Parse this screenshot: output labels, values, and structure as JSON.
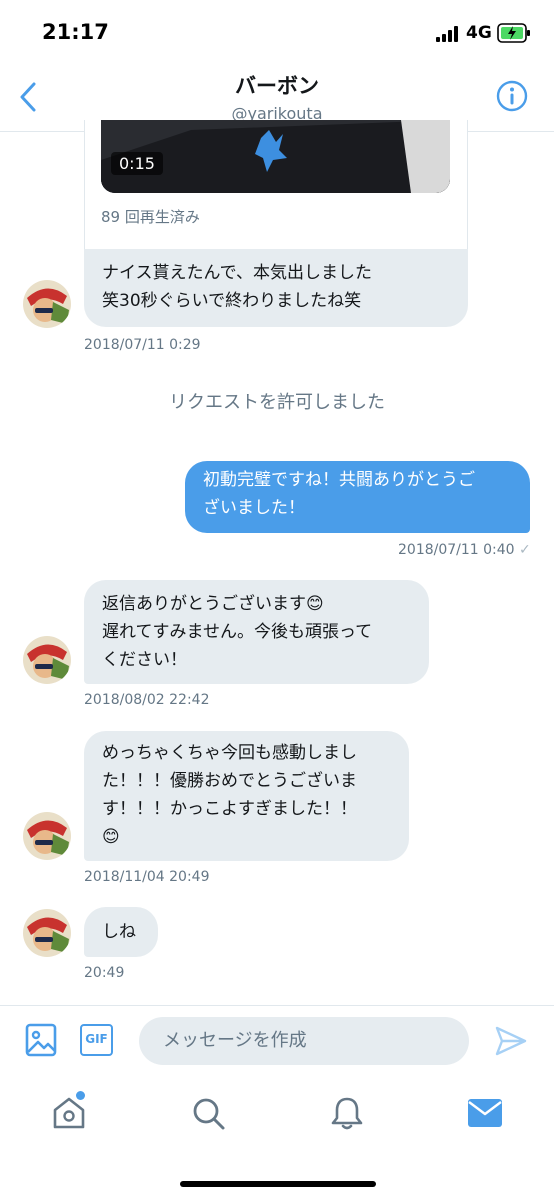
{
  "status_bar": {
    "time": "21:17",
    "network": "4G"
  },
  "header": {
    "title": "バーボン",
    "handle": "@yarikouta"
  },
  "media": {
    "duration": "0:15",
    "views": "89 回再生済み"
  },
  "messages": [
    {
      "side": "in",
      "lines": [
        "ナイス貰えたんで、本気出しました",
        "笑30秒ぐらいで終わりましたね笑"
      ],
      "timestamp": "2018/07/11 0:29"
    },
    {
      "side": "out",
      "lines": [
        "初動完璧ですね！共闘ありがとうご",
        "ざいました！"
      ],
      "timestamp": "2018/07/11 0:40"
    },
    {
      "side": "in",
      "lines": [
        "返信ありがとうございます😊",
        "遅れてすみません。今後も頑張って",
        "ください！"
      ],
      "timestamp": "2018/08/02 22:42"
    },
    {
      "side": "in",
      "lines": [
        "めっちゃくちゃ今回も感動しまし",
        "た！！！優勝おめでとうございま",
        "す！！！かっこよすぎました！！",
        "😊"
      ],
      "timestamp": "2018/11/04 20:49"
    },
    {
      "side": "in",
      "lines": [
        "しね"
      ],
      "timestamp": "20:49"
    }
  ],
  "system_notice": "リクエストを許可しました",
  "compose": {
    "placeholder": "メッセージを作成",
    "gif_label": "GIF"
  },
  "colors": {
    "accent": "#4a9de9",
    "bubble_in": "#e6ecf0",
    "muted": "#657786"
  }
}
